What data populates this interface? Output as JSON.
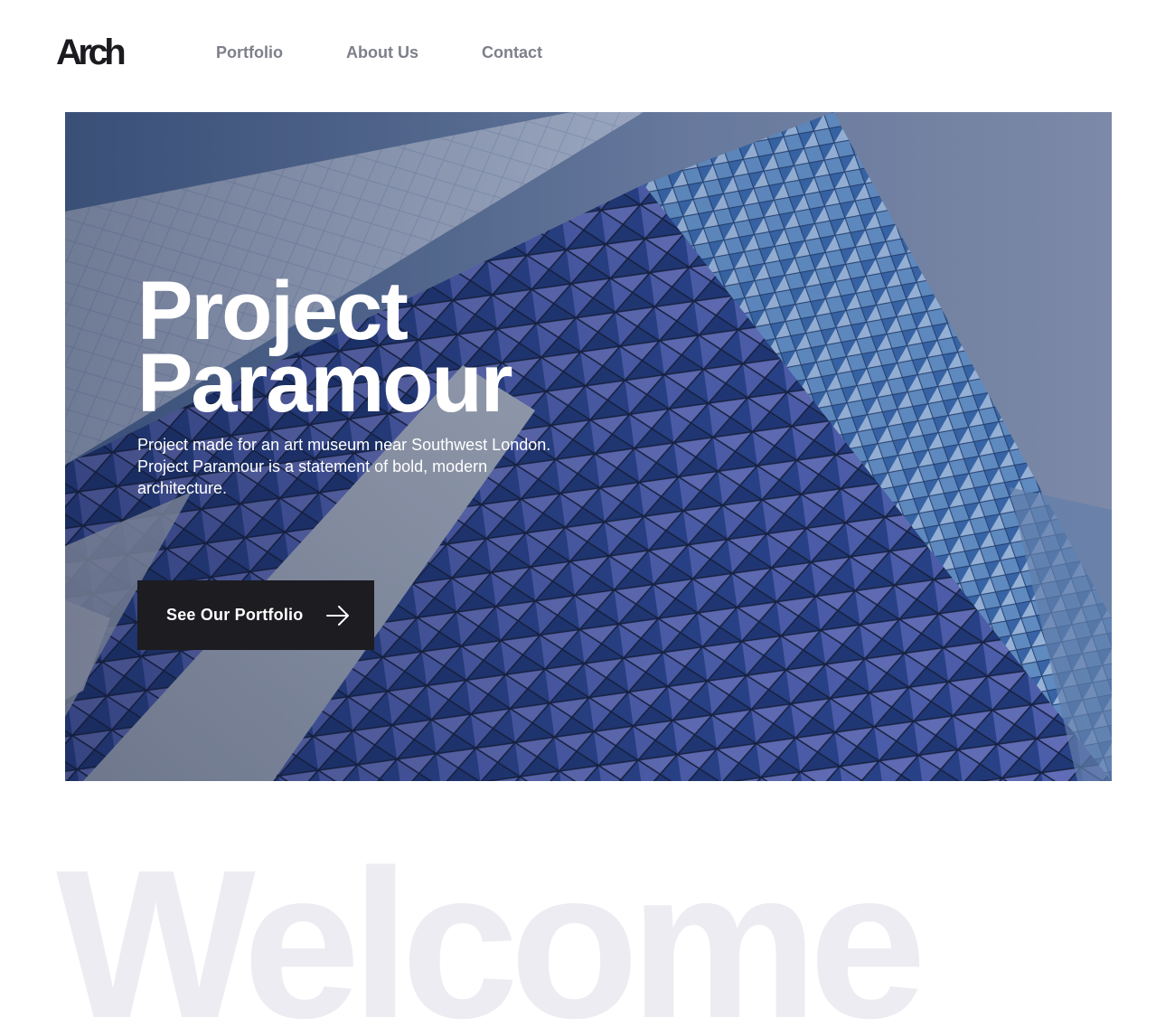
{
  "header": {
    "logo": "Arch",
    "nav": [
      {
        "label": "Portfolio"
      },
      {
        "label": "About Us"
      },
      {
        "label": "Contact"
      }
    ]
  },
  "hero": {
    "title_line1": "Project",
    "title_line2": "Paramour",
    "description": "Project made for an art museum near Southwest London. Project Paramour is a statement of bold, modern architecture.",
    "cta_label": "See Our Portfolio",
    "cta_icon": "arrow-right-icon",
    "background": "blue-glass-facade-building-photo"
  },
  "welcome": {
    "heading": "Welcome"
  },
  "colors": {
    "logo": "#1b1b1f",
    "nav": "#7d7f8a",
    "cta_bg": "#1c1c21",
    "welcome": "#ececf2",
    "hero_sky": "#8796b1",
    "hero_glass": "#3b56a0"
  }
}
